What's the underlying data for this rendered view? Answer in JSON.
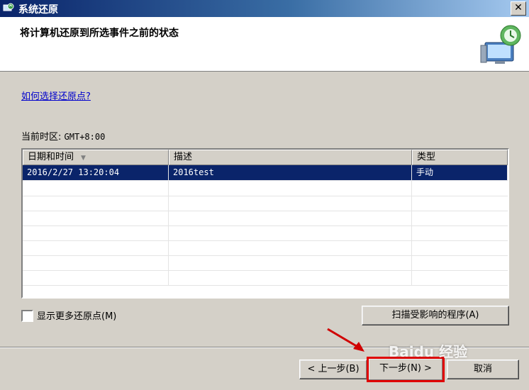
{
  "window": {
    "title": "系统还原",
    "close_label": "✕"
  },
  "header": {
    "heading": "将计算机还原到所选事件之前的状态"
  },
  "help_link": "如何选择还原点?",
  "timezone": {
    "label": "当前时区:",
    "value": "GMT+8:00"
  },
  "table": {
    "columns": [
      "日期和时间",
      "描述",
      "类型"
    ],
    "rows": [
      {
        "datetime": "2016/2/27 13:20:04",
        "description": "2016test",
        "type": "手动",
        "selected": true
      }
    ]
  },
  "show_more_label": "显示更多还原点(M)",
  "buttons": {
    "scan": "扫描受影响的程序(A)",
    "back": "< 上一步(B)",
    "next": "下一步(N) >",
    "cancel": "取消"
  },
  "watermark": "Baidu 经验",
  "colors": {
    "selection": "#0a246a",
    "highlight": "#e00000",
    "link": "#0000cc"
  },
  "icons": {
    "window": "system-restore-icon",
    "header": "computer-restore-icon"
  }
}
